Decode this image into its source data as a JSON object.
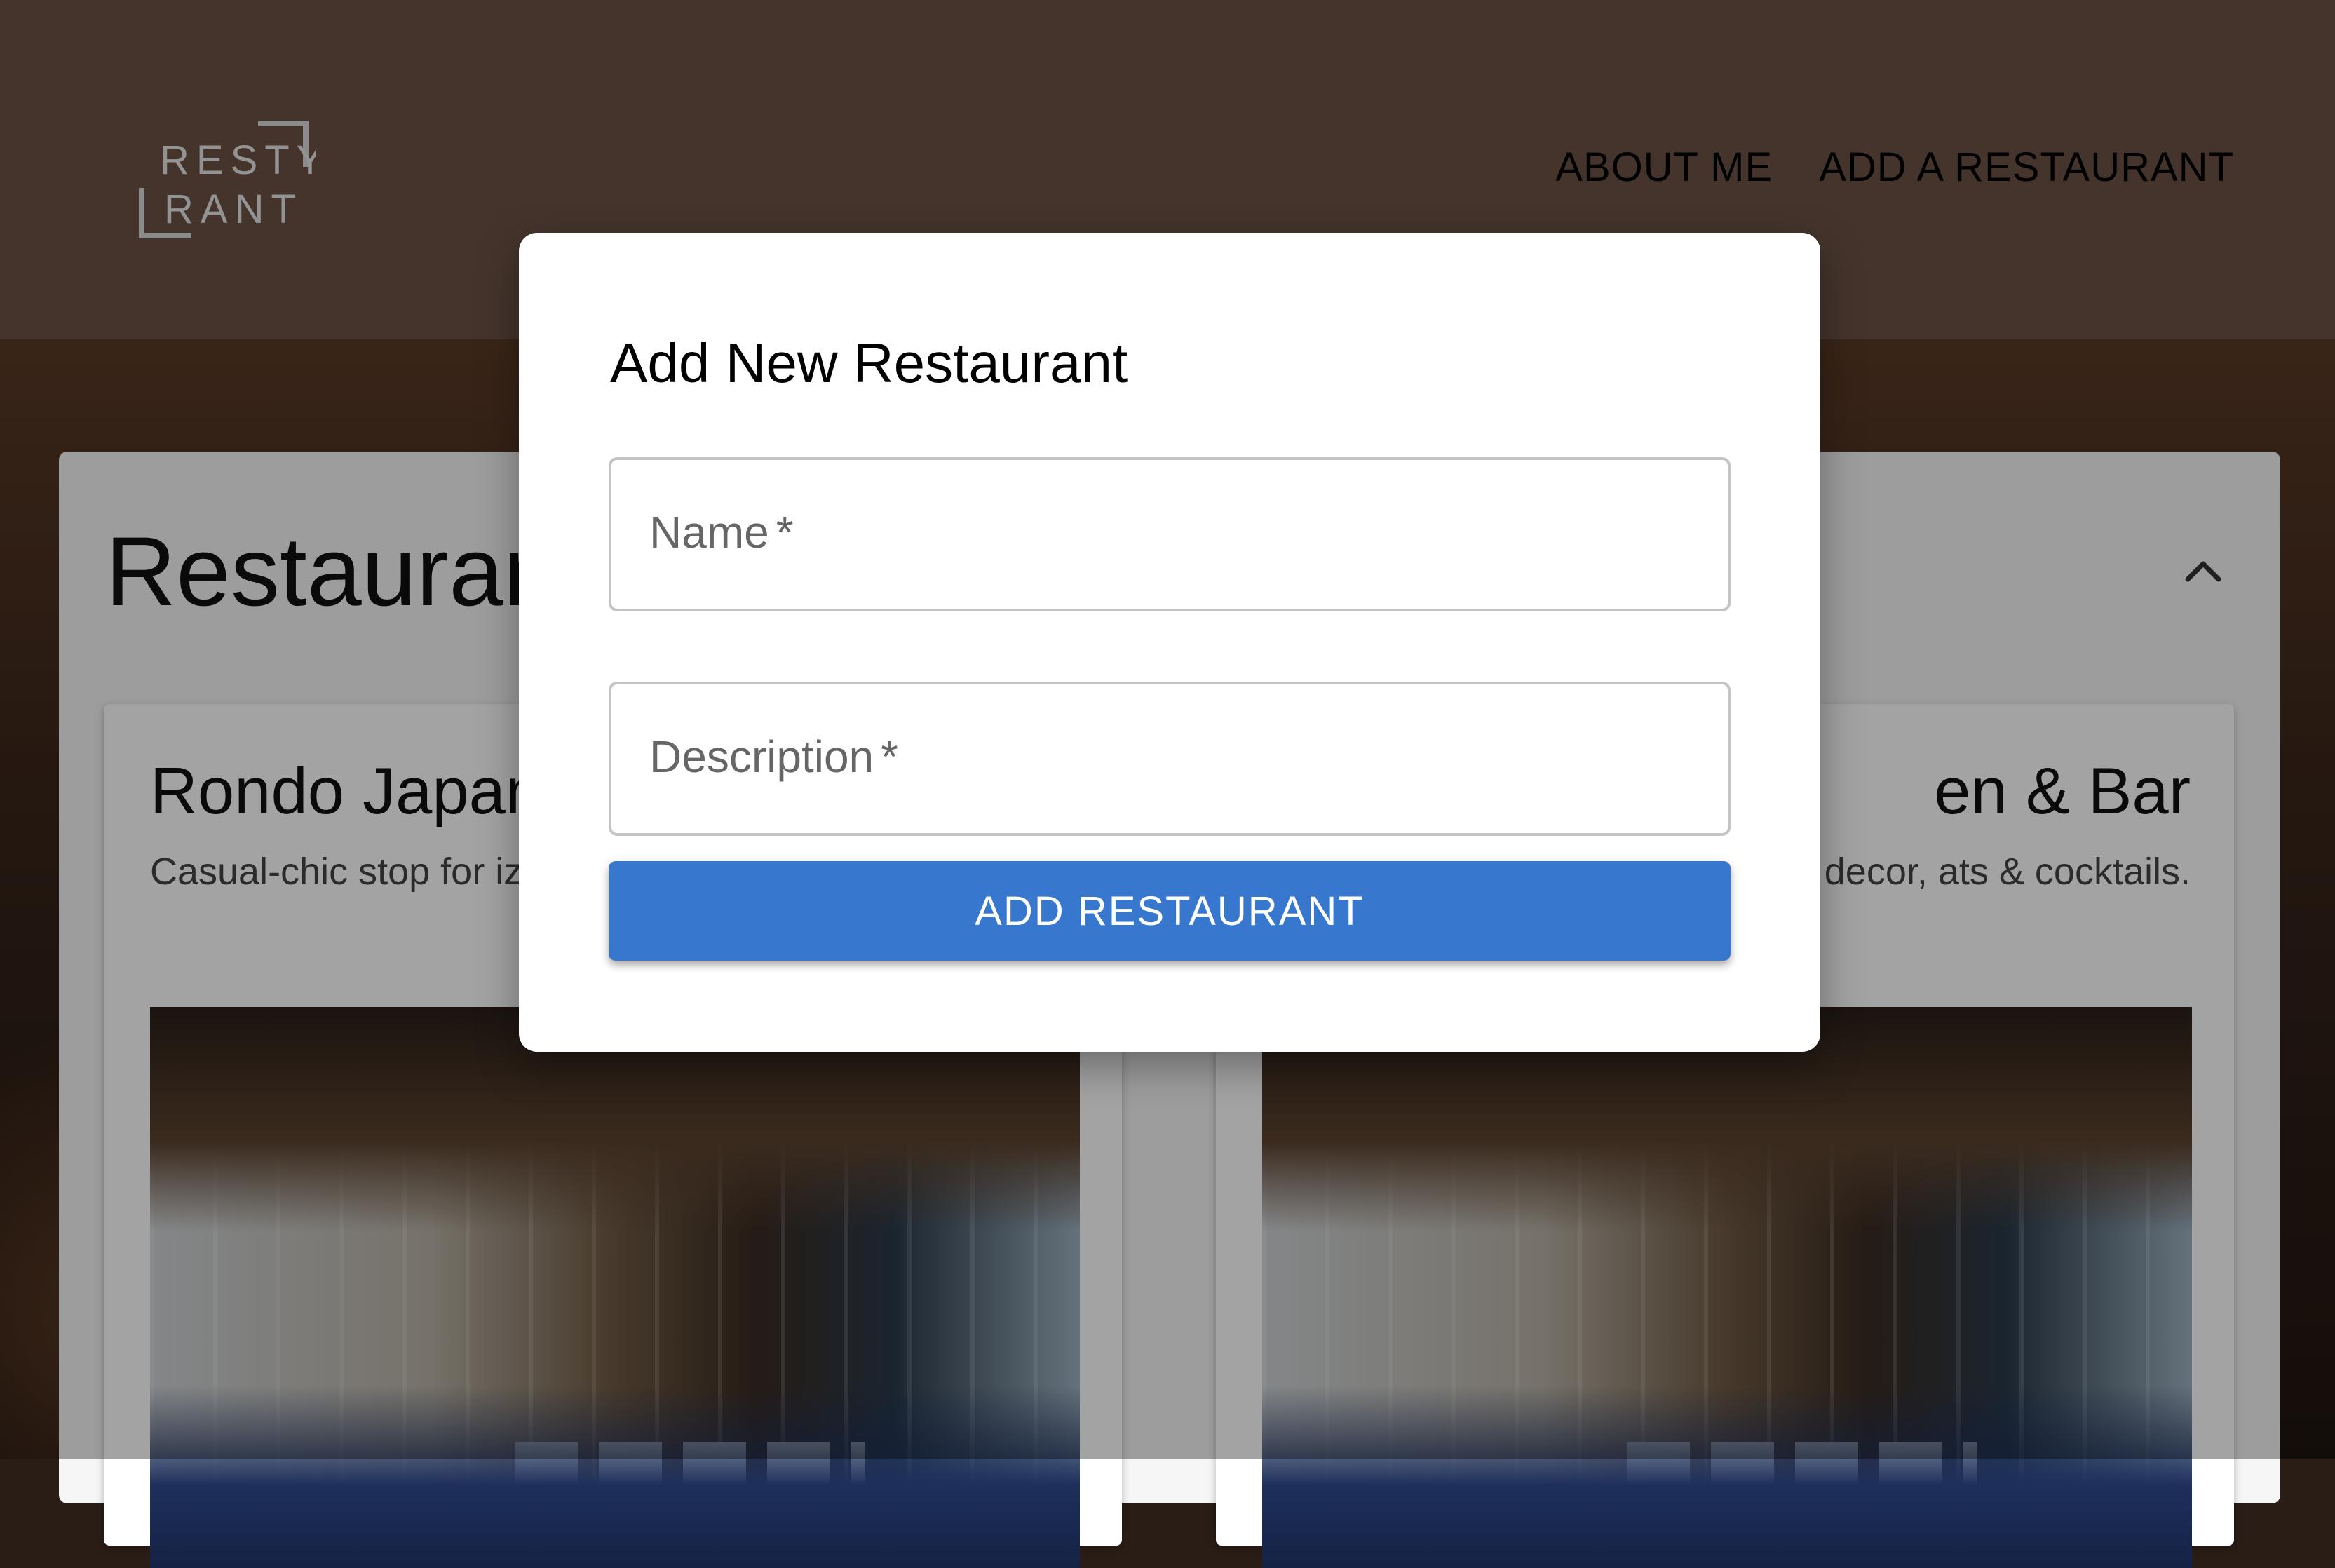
{
  "header": {
    "logo": {
      "line1": "RESTY",
      "line2": "RANT"
    },
    "nav": [
      {
        "label": "ABOUT ME"
      },
      {
        "label": "ADD A RESTAURANT"
      }
    ]
  },
  "main": {
    "section_title": "Restaurants",
    "cards": [
      {
        "title": "Rondo Japan",
        "description": "Casual-chic stop for izakaya-style snacks"
      },
      {
        "title": "en & Bar",
        "description": "west-inspired decor, ats & cocktails."
      }
    ]
  },
  "dialog": {
    "title": "Add New Restaurant",
    "fields": [
      {
        "label": "Name",
        "required_mark": "*"
      },
      {
        "label": "Description",
        "required_mark": "*"
      }
    ],
    "submit_label": "ADD RESTAURANT"
  },
  "colors": {
    "header_bg": "#6b5245",
    "accent_button": "#3777cd"
  },
  "icons": {
    "collapse": "chevron-up-icon"
  }
}
